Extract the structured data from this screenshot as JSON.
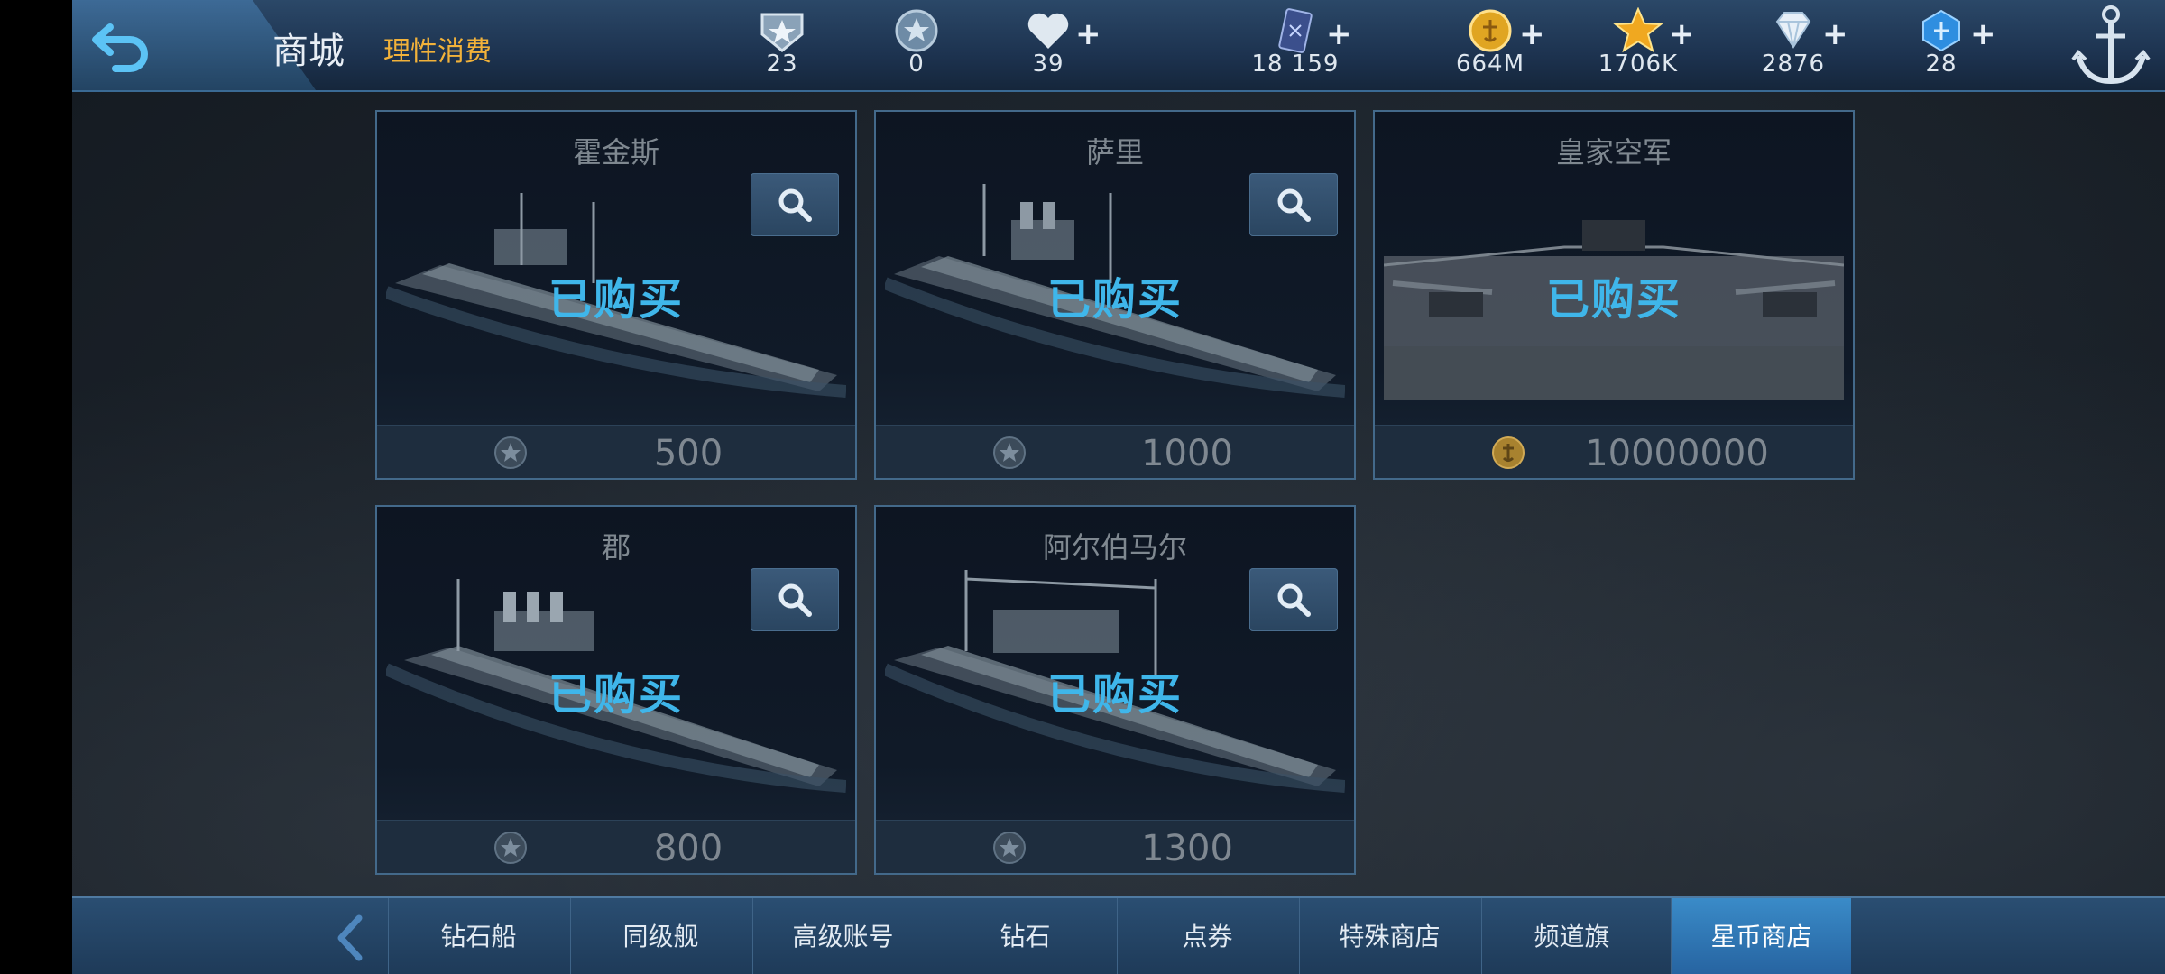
{
  "header": {
    "title": "商城",
    "subtitle": "理性消费",
    "resources": [
      {
        "icon": "rank-badge-icon",
        "value": "23",
        "plus": false
      },
      {
        "icon": "star-coin-icon",
        "value": "0",
        "plus": false
      },
      {
        "icon": "heart-icon",
        "value": "39",
        "plus": true
      },
      {
        "icon": "card-icon",
        "value": "18 159",
        "plus": true
      },
      {
        "icon": "gold-coin-icon",
        "value": "664M",
        "plus": true
      },
      {
        "icon": "star-icon",
        "value": "1706K",
        "plus": true
      },
      {
        "icon": "diamond-icon",
        "value": "2876",
        "plus": true
      },
      {
        "icon": "blue-gem-icon",
        "value": "28",
        "plus": true
      }
    ]
  },
  "cards": [
    {
      "name": "霍金斯",
      "status": "已购买",
      "price": "500",
      "currency": "star-coin-icon"
    },
    {
      "name": "萨里",
      "status": "已购买",
      "price": "1000",
      "currency": "star-coin-icon"
    },
    {
      "name": "皇家空军",
      "status": "已购买",
      "price": "10000000",
      "currency": "gold-coin-icon"
    },
    {
      "name": "郡",
      "status": "已购买",
      "price": "800",
      "currency": "star-coin-icon"
    },
    {
      "name": "阿尔伯马尔",
      "status": "已购买",
      "price": "1300",
      "currency": "star-coin-icon"
    }
  ],
  "tabs": [
    "钻石船",
    "同级舰",
    "高级账号",
    "钻石",
    "点券",
    "特殊商店",
    "频道旗",
    "星币商店"
  ],
  "active_tab": "星币商店",
  "colors": {
    "accent": "#3fb6ea",
    "subtitle": "#f2b23a"
  }
}
